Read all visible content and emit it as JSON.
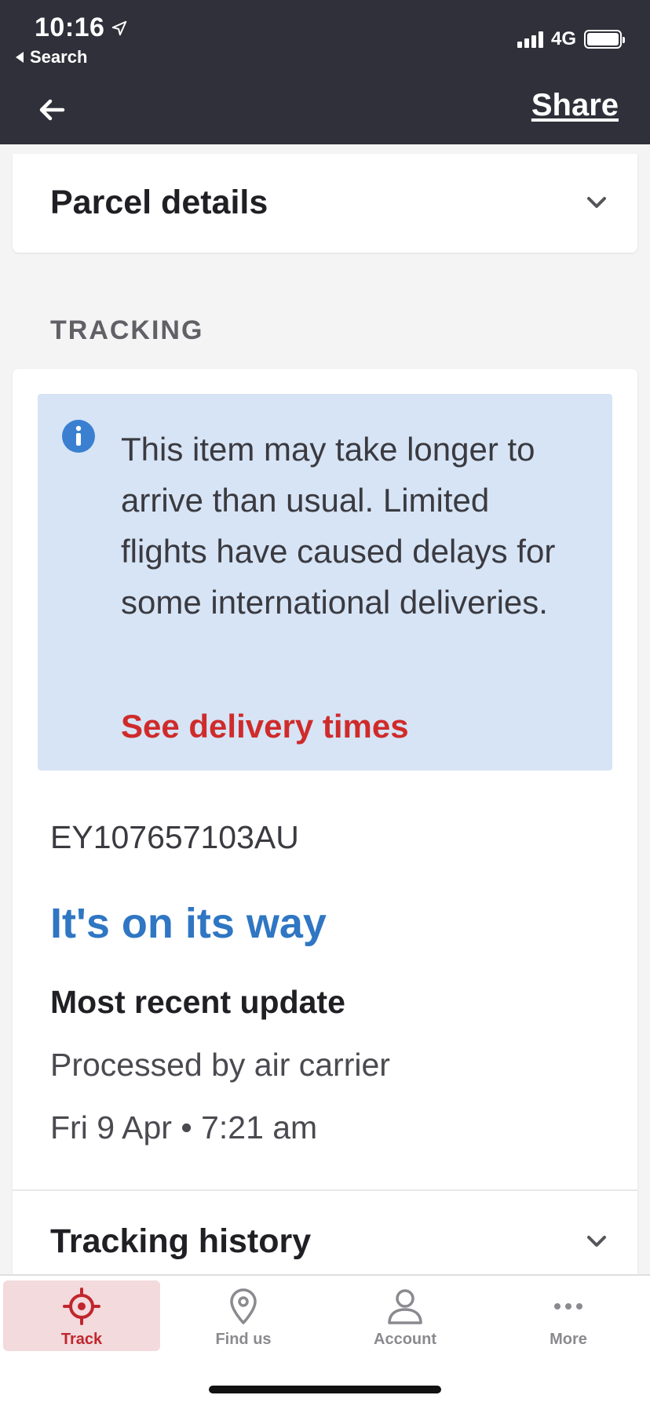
{
  "status_bar": {
    "time": "10:16",
    "back_app_label": "Search",
    "network": "4G"
  },
  "header": {
    "share_label": "Share"
  },
  "parcel_details": {
    "title": "Parcel details"
  },
  "tracking": {
    "section_label": "TRACKING",
    "notice": {
      "text": "This item may take longer to arrive than usual. Limited flights have caused delays for some international deliveries.",
      "link_label": "See delivery times"
    },
    "tracking_number": "EY107657103AU",
    "status": "It's on its way",
    "update_heading": "Most recent update",
    "update_event": "Processed by air carrier",
    "update_time": "Fri 9 Apr • 7:21 am",
    "history_title": "Tracking history"
  },
  "tabbar": {
    "items": [
      {
        "label": "Track",
        "icon": "crosshair-icon",
        "active": true
      },
      {
        "label": "Find us",
        "icon": "location-pin-icon",
        "active": false
      },
      {
        "label": "Account",
        "icon": "person-icon",
        "active": false
      },
      {
        "label": "More",
        "icon": "more-dots-icon",
        "active": false
      }
    ]
  },
  "colors": {
    "header_bg": "#2f3039",
    "accent_red": "#cf2b2b",
    "status_blue": "#2f76c3",
    "notice_bg": "#d6e4f5",
    "active_tab_bg": "#f2dadd"
  }
}
